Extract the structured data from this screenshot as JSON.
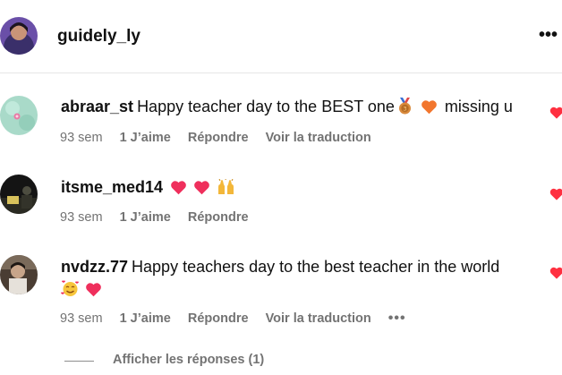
{
  "post": {
    "username": "guidely_ly",
    "more_icon": "more-horizontal-icon"
  },
  "comments": [
    {
      "author": "abraar_st",
      "text_before": "Happy teacher day to the BEST one",
      "emojis": [
        "medal-emoji",
        "orange-heart-emoji"
      ],
      "text_after": "missing u",
      "time": "93 sem",
      "likes": "1 J’aime",
      "reply": "Répondre",
      "translate": "Voir la traduction"
    },
    {
      "author": "itsme_med14",
      "emojis": [
        "heart-emoji",
        "heart-emoji",
        "raised-hands-emoji"
      ],
      "time": "93 sem",
      "likes": "1 J’aime",
      "reply": "Répondre"
    },
    {
      "author": "nvdzz.77",
      "text_before": "Happy teachers day to the best teacher in the world",
      "emojis": [
        "smiling-face-with-hearts-emoji",
        "heart-emoji"
      ],
      "time": "93 sem",
      "likes": "1 J’aime",
      "reply": "Répondre",
      "translate": "Voir la traduction",
      "more_icon": "more-horizontal-icon"
    }
  ],
  "replies_toggle": "Afficher les réponses (1)",
  "colors": {
    "secondary_text": "#737373",
    "heart_red": "#ff3040",
    "divider": "#e6e6e6"
  }
}
